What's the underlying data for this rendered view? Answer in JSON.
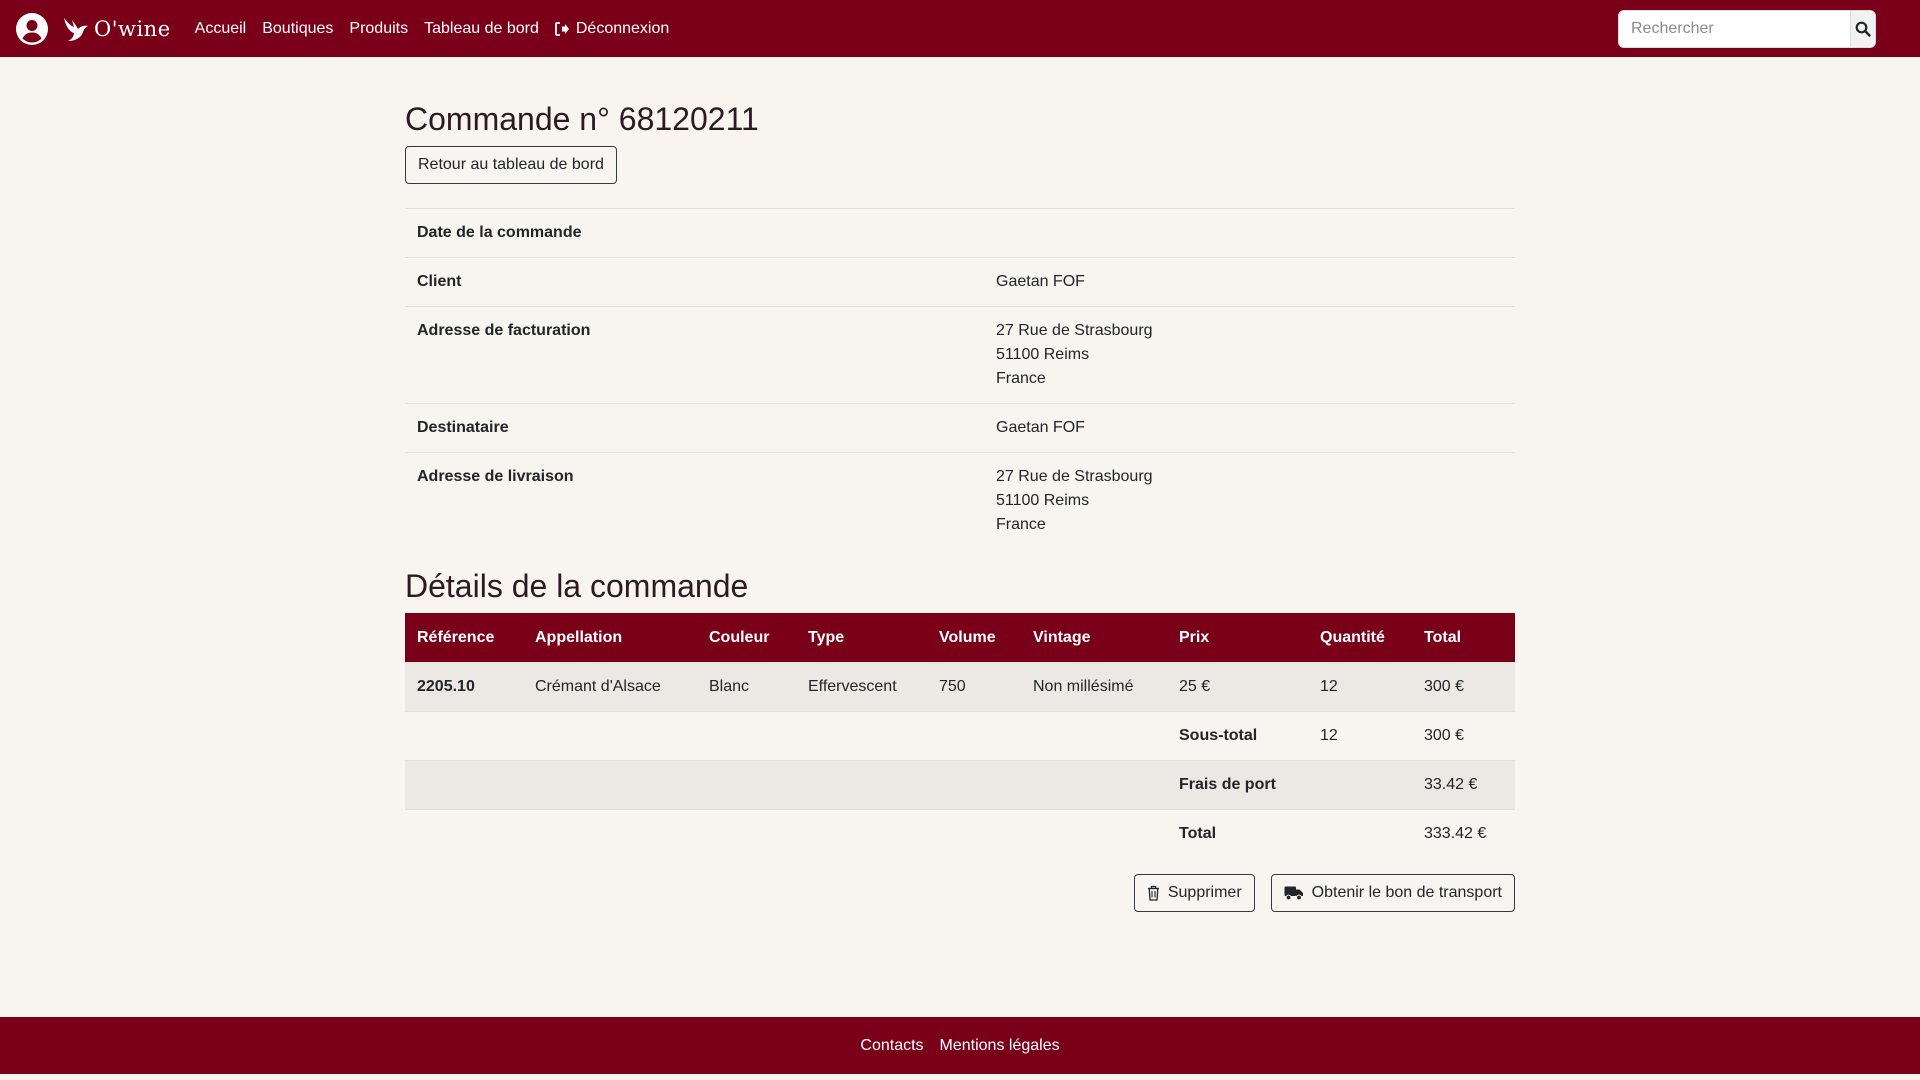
{
  "navbar": {
    "logo_text": "O'wine",
    "links": [
      "Accueil",
      "Boutiques",
      "Produits",
      "Tableau de bord",
      "Déconnexion"
    ],
    "search_placeholder": "Rechercher"
  },
  "colors": {
    "brand": "#7a0019",
    "background": "#f8f5f0",
    "stripe": "#ece9e4"
  },
  "order": {
    "title": "Commande n° 68120211",
    "back_button": "Retour au tableau de bord",
    "info": [
      {
        "label": "Date de la commande",
        "value": []
      },
      {
        "label": "Client",
        "value": [
          "Gaetan FOF"
        ]
      },
      {
        "label": "Adresse de facturation",
        "value": [
          "27 Rue de Strasbourg",
          "51100 Reims",
          "France"
        ]
      },
      {
        "label": "Destinataire",
        "value": [
          "Gaetan FOF"
        ]
      },
      {
        "label": "Adresse de livraison",
        "value": [
          "27 Rue de Strasbourg",
          "51100 Reims",
          "France"
        ]
      }
    ]
  },
  "details": {
    "title": "Détails de la commande",
    "columns": [
      "Référence",
      "Appellation",
      "Couleur",
      "Type",
      "Volume",
      "Vintage",
      "Prix",
      "Quantité",
      "Total"
    ],
    "rows": [
      [
        "2205.10",
        "Crémant d'Alsace",
        "Blanc",
        "Effervescent",
        "750",
        "Non millésimé",
        "25 €",
        "12",
        "300 €"
      ]
    ],
    "subtotal": {
      "label": "Sous-total",
      "quantity": "12",
      "total": "300 €"
    },
    "shipping": {
      "label": "Frais de port",
      "total": "33.42 €"
    },
    "grand_total": {
      "label": "Total",
      "total": "333.42 €"
    }
  },
  "actions": {
    "delete": "Supprimer",
    "transport": "Obtenir le bon de transport"
  },
  "footer": {
    "links": [
      "Contacts",
      "Mentions légales"
    ]
  }
}
